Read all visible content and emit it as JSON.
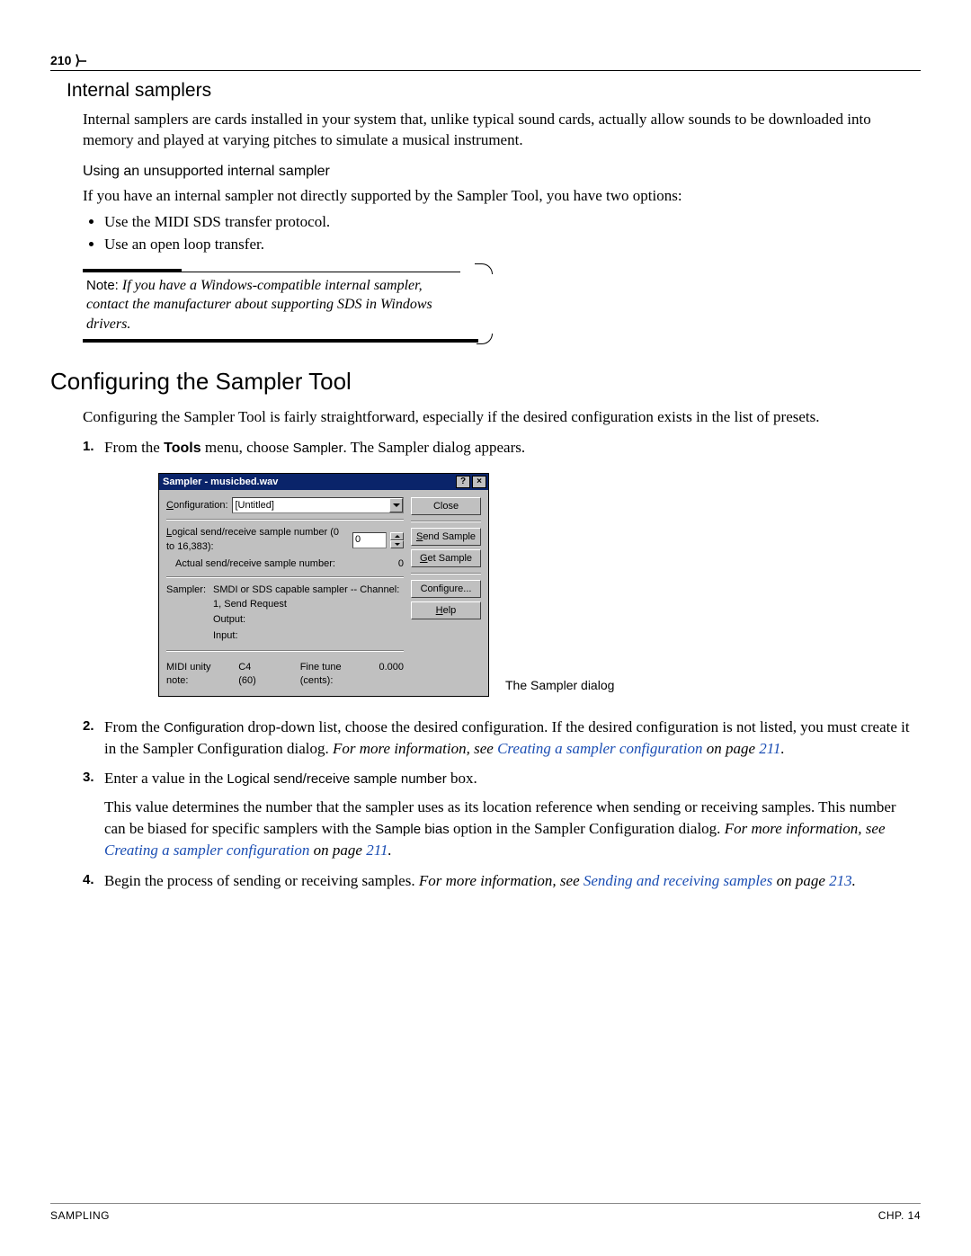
{
  "page_number": "210",
  "sections": {
    "internal_samplers": {
      "heading": "Internal samplers",
      "para": "Internal samplers are cards installed in your system that, unlike typical sound cards, actually allow sounds to be downloaded into memory and played at varying pitches to simulate a musical instrument.",
      "sub_heading": "Using an unsupported internal sampler",
      "sub_para": "If you have an internal sampler not directly supported by the Sampler Tool, you have two options:",
      "bullets": [
        "Use the MIDI SDS transfer protocol.",
        "Use an open loop transfer."
      ],
      "note_label": "Note:",
      "note_body": "If you have a Windows-compatible internal sampler, contact the manufacturer about supporting SDS in Windows drivers."
    },
    "configuring": {
      "heading": "Configuring the Sampler Tool",
      "intro": "Configuring the Sampler Tool is fairly straightforward, especially if the desired configuration exists in the list of presets.",
      "steps": {
        "s1_pre": "From the ",
        "s1_tools": "Tools",
        "s1_mid": " menu, choose ",
        "s1_sampler": "Sampler",
        "s1_post": ". The Sampler dialog appears.",
        "s2_pre": "From the ",
        "s2_conf": "Configuration",
        "s2_mid": " drop-down list, choose the desired configuration. If the desired configuration is not listed, you must create it in the Sampler Configuration dialog. ",
        "s2_info": "For more information, see ",
        "s2_link": "Creating a sampler configuration",
        "s2_on": " on page ",
        "s2_page": "211",
        "s2_end": ".",
        "s3_pre": "Enter a value in the ",
        "s3_box": "Logical send/receive sample number",
        "s3_post": " box.",
        "s3_sub_a": "This value determines the number that the sampler uses as its location reference when sending or receiving samples. This number can be biased for specific samplers with the ",
        "s3_bias": "Sample bias",
        "s3_sub_b": " option in the Sampler Configuration dialog. ",
        "s3_info": "For more information, see ",
        "s3_link": "Creating a sampler configuration",
        "s3_on": " on page ",
        "s3_page": "211",
        "s3_end": ".",
        "s4_pre": "Begin the process of sending or receiving samples. ",
        "s4_info": "For more information, see ",
        "s4_link": "Sending and receiving samples",
        "s4_on": " on page ",
        "s4_page": "213",
        "s4_end": "."
      }
    }
  },
  "dialog": {
    "title": "Sampler - musicbed.wav",
    "help_icon": "?",
    "close_icon": "×",
    "configuration_label": "Configuration:",
    "configuration_value": "[Untitled]",
    "logical_label": "Logical send/receive sample number (0 to 16,383):",
    "logical_value": "0",
    "actual_label": "Actual send/receive sample number:",
    "actual_value": "0",
    "sampler_label": "Sampler:",
    "sampler_text": "SMDI or SDS capable sampler -- Channel: 1, Send Request",
    "output_label": "Output:",
    "input_label": "Input:",
    "midi_unity_label": "MIDI unity note:",
    "midi_unity_value": "C4 (60)",
    "fine_tune_label": "Fine tune (cents):",
    "fine_tune_value": "0.000",
    "buttons": {
      "close": "Close",
      "send": "Send Sample",
      "get": "Get Sample",
      "configure": "Configure...",
      "help": "Help"
    },
    "caption": "The Sampler dialog"
  },
  "footer": {
    "left": "SAMPLING",
    "right": "CHP. 14"
  }
}
